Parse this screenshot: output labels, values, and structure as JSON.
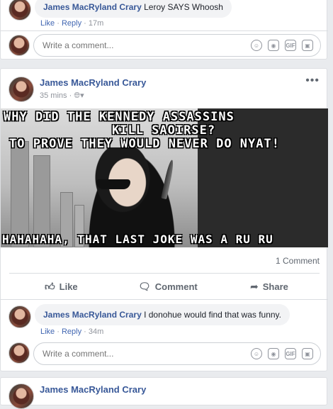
{
  "top_comment": {
    "author": "James MacRyland Crary",
    "text": "Leroy SAYS Whoosh",
    "like": "Like",
    "reply": "Reply",
    "time": "17m"
  },
  "comment_box_1": {
    "placeholder": "Write a comment..."
  },
  "post": {
    "author": "James MacRyland Crary",
    "time": "35 mins",
    "privacy_icon": "globe-icon",
    "meme": {
      "line1": "WHY DID THE KENNEDY ASSASSINS",
      "line2": "KILL SAOIRSE?",
      "line3": "TO PROVE THEY WOULD NEVER DO NYAT!",
      "bottom": "HAHAHAHA, THAT LAST JOKE WAS A RU RU"
    },
    "comment_count": "1 Comment",
    "actions": {
      "like": "Like",
      "comment": "Comment",
      "share": "Share"
    }
  },
  "reply_comment": {
    "author": "James MacRyland Crary",
    "text": "I donohue would find that was funny.",
    "like": "Like",
    "reply": "Reply",
    "time": "34m"
  },
  "comment_box_2": {
    "placeholder": "Write a comment..."
  },
  "next_post": {
    "author": "James MacRyland Crary"
  },
  "colors": {
    "link": "#385898",
    "meta": "#90949c",
    "bg": "#e9ebee"
  }
}
